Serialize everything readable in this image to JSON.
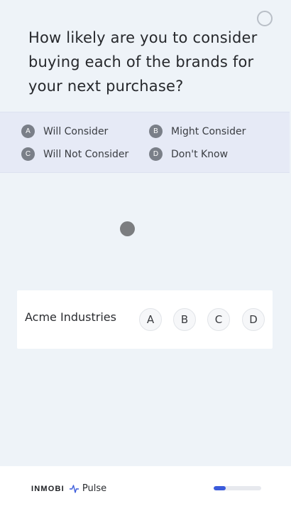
{
  "question": {
    "text": "How likely are you to consider buying each of the brands for your next purchase?"
  },
  "legend": {
    "items": [
      {
        "badge": "A",
        "label": "Will Consider"
      },
      {
        "badge": "B",
        "label": "Might Consider"
      },
      {
        "badge": "C",
        "label": "Will Not Consider"
      },
      {
        "badge": "D",
        "label": "Don't Know"
      }
    ]
  },
  "brand_row": {
    "name": "Acme Industries",
    "options": [
      "A",
      "B",
      "C",
      "D"
    ]
  },
  "footer": {
    "brand": "INMOBI",
    "product": "Pulse",
    "progress_fraction": 0.25
  },
  "colors": {
    "progress_fill": "#3b5bdb",
    "badge": "#7a7f88",
    "legend_bg": "#e6eaf6"
  },
  "icons": {
    "close": "close-circle-icon",
    "pulse": "pulse-wave-icon",
    "loading": "loading-dot-icon"
  }
}
